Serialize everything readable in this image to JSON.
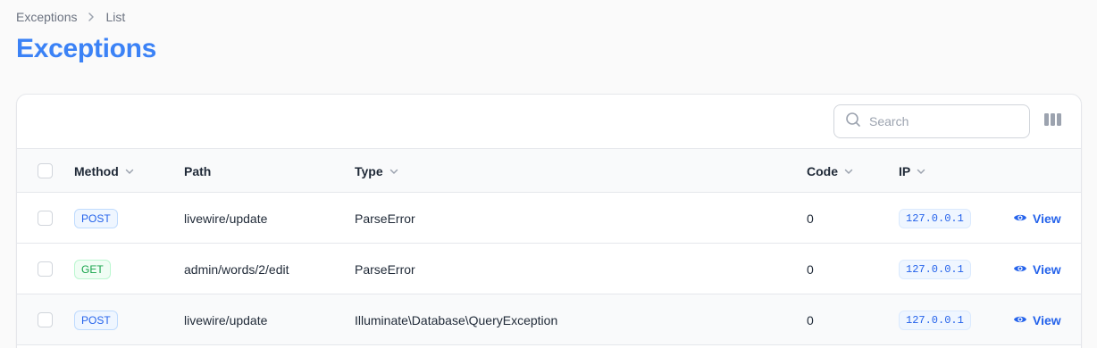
{
  "breadcrumb": {
    "parent": "Exceptions",
    "current": "List"
  },
  "page": {
    "title": "Exceptions"
  },
  "search": {
    "placeholder": "Search",
    "value": ""
  },
  "table": {
    "headers": {
      "method": "Method",
      "path": "Path",
      "type": "Type",
      "code": "Code",
      "ip": "IP"
    },
    "rows": [
      {
        "method": "POST",
        "path": "livewire/update",
        "type": "ParseError",
        "code": "0",
        "ip": "127.0.0.1",
        "action": "View"
      },
      {
        "method": "GET",
        "path": "admin/words/2/edit",
        "type": "ParseError",
        "code": "0",
        "ip": "127.0.0.1",
        "action": "View"
      },
      {
        "method": "POST",
        "path": "livewire/update",
        "type": "Illuminate\\Database\\QueryException",
        "code": "0",
        "ip": "127.0.0.1",
        "action": "View"
      }
    ]
  },
  "icons": {
    "breadcrumb_separator": "chevron-right-icon",
    "search": "search-icon",
    "columns": "columns-icon",
    "sort": "chevron-down-icon",
    "view": "eye-icon"
  },
  "colors": {
    "accent": "#3b82f6",
    "link": "#2563eb",
    "post_badge": "#2563eb",
    "get_badge": "#16a34a"
  }
}
